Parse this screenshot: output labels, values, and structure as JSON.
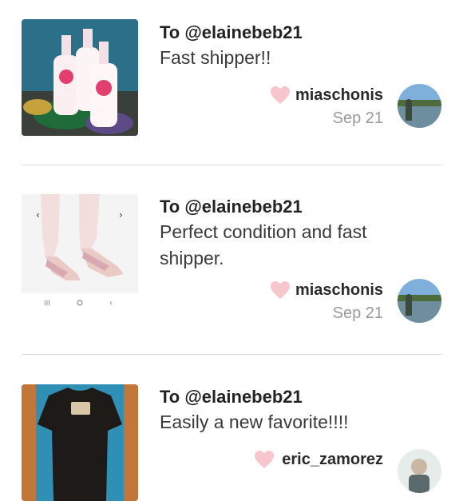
{
  "reviews": [
    {
      "to": "To @elainebeb21",
      "message": "Fast shipper!!",
      "username": "miaschonis",
      "date": "Sep 21"
    },
    {
      "to": "To @elainebeb21",
      "message": "Perfect condition and fast shipper.",
      "username": "miaschonis",
      "date": "Sep 21"
    },
    {
      "to": "To @elainebeb21",
      "message": "Easily a new favorite!!!!",
      "username": "eric_zamorez",
      "date": ""
    }
  ],
  "colors": {
    "heart": "#f7c5cc",
    "divider": "#d9d9d9",
    "date": "#9a9a9a"
  },
  "icons": [
    "heart-icon",
    "chevron-left-icon",
    "chevron-right-icon"
  ]
}
